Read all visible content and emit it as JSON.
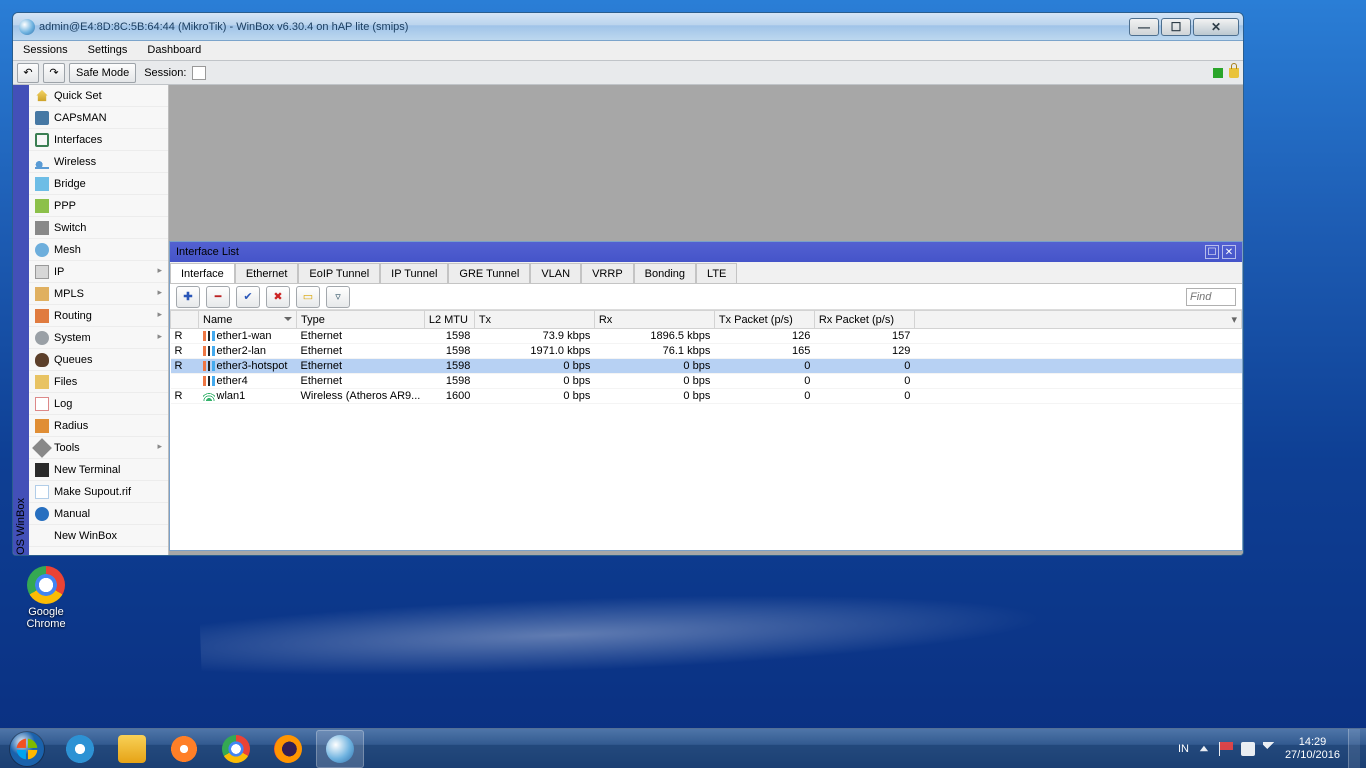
{
  "window": {
    "title": "admin@E4:8D:8C:5B:64:44 (MikroTik) - WinBox v6.30.4 on hAP lite (smips)"
  },
  "menubar": {
    "items": [
      "Sessions",
      "Settings",
      "Dashboard"
    ]
  },
  "toolbar": {
    "undo_glyph": "↶",
    "redo_glyph": "↷",
    "safe_mode": "Safe Mode",
    "session_label": "Session:"
  },
  "vbar": {
    "label": "outerOS WinBox"
  },
  "sidebar": {
    "items": [
      {
        "label": "Quick Set",
        "ic": "si-home"
      },
      {
        "label": "CAPsMAN",
        "ic": "si-ant"
      },
      {
        "label": "Interfaces",
        "ic": "si-net"
      },
      {
        "label": "Wireless",
        "ic": "si-wave"
      },
      {
        "label": "Bridge",
        "ic": "si-bridge"
      },
      {
        "label": "PPP",
        "ic": "si-ppp"
      },
      {
        "label": "Switch",
        "ic": "si-switch"
      },
      {
        "label": "Mesh",
        "ic": "si-mesh"
      },
      {
        "label": "IP",
        "ic": "si-ip",
        "sub": true
      },
      {
        "label": "MPLS",
        "ic": "si-mpls",
        "sub": true
      },
      {
        "label": "Routing",
        "ic": "si-route",
        "sub": true
      },
      {
        "label": "System",
        "ic": "si-sys",
        "sub": true
      },
      {
        "label": "Queues",
        "ic": "si-queue"
      },
      {
        "label": "Files",
        "ic": "si-folder"
      },
      {
        "label": "Log",
        "ic": "si-log"
      },
      {
        "label": "Radius",
        "ic": "si-radius"
      },
      {
        "label": "Tools",
        "ic": "si-tools",
        "sub": true
      },
      {
        "label": "New Terminal",
        "ic": "si-term"
      },
      {
        "label": "Make Supout.rif",
        "ic": "si-rif"
      },
      {
        "label": "Manual",
        "ic": "si-man"
      },
      {
        "label": "New WinBox",
        "ic": ""
      }
    ]
  },
  "inner": {
    "title": "Interface List",
    "tabs": [
      "Interface",
      "Ethernet",
      "EoIP Tunnel",
      "IP Tunnel",
      "GRE Tunnel",
      "VLAN",
      "VRRP",
      "Bonding",
      "LTE"
    ],
    "find_placeholder": "Find",
    "columns": [
      "",
      "Name",
      "Type",
      "L2 MTU",
      "Tx",
      "Rx",
      "Tx Packet (p/s)",
      "Rx Packet (p/s)"
    ],
    "rows": [
      {
        "flag": "R",
        "name": "ether1-wan",
        "type": "Ethernet",
        "mtu": "1598",
        "tx": "73.9 kbps",
        "rx": "1896.5 kbps",
        "txp": "126",
        "rxp": "157",
        "eth": true
      },
      {
        "flag": "R",
        "name": "ether2-lan",
        "type": "Ethernet",
        "mtu": "1598",
        "tx": "1971.0 kbps",
        "rx": "76.1 kbps",
        "txp": "165",
        "rxp": "129",
        "eth": true
      },
      {
        "flag": "R",
        "name": "ether3-hotspot",
        "type": "Ethernet",
        "mtu": "1598",
        "tx": "0 bps",
        "rx": "0 bps",
        "txp": "0",
        "rxp": "0",
        "eth": true,
        "sel": true
      },
      {
        "flag": "",
        "name": "ether4",
        "type": "Ethernet",
        "mtu": "1598",
        "tx": "0 bps",
        "rx": "0 bps",
        "txp": "0",
        "rxp": "0",
        "eth": true
      },
      {
        "flag": "R",
        "name": "wlan1",
        "type": "Wireless (Atheros AR9...",
        "mtu": "1600",
        "tx": "0 bps",
        "rx": "0 bps",
        "txp": "0",
        "rxp": "0",
        "eth": false
      }
    ]
  },
  "desktop": {
    "chrome": "Google Chrome"
  },
  "tray": {
    "lang": "IN",
    "time": "14:29",
    "date": "27/10/2016"
  }
}
